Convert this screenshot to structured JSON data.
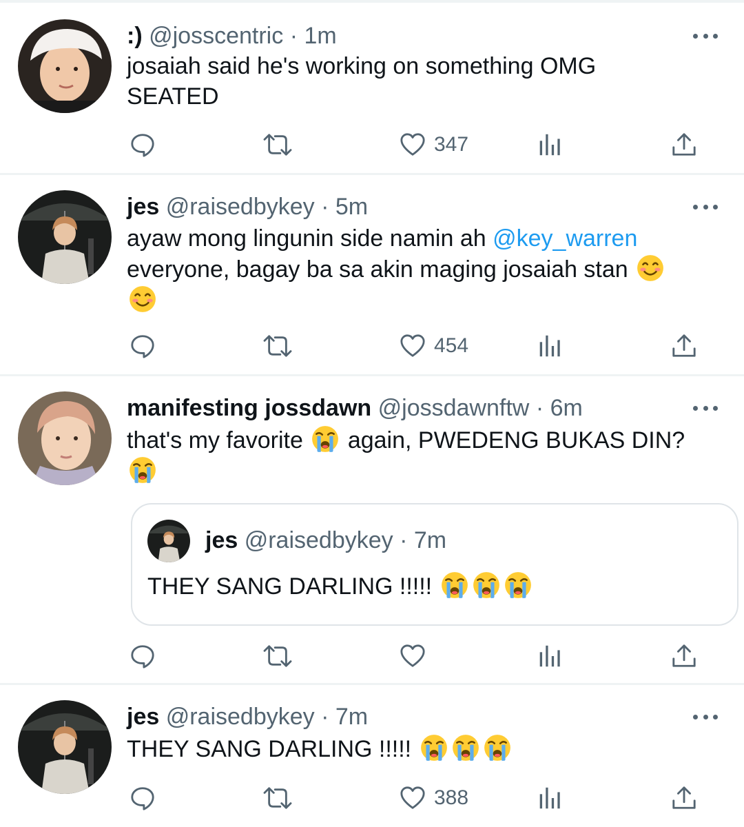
{
  "tweets": [
    {
      "name": ":)",
      "handle": "@josscentric",
      "separator": "·",
      "time": "1m",
      "text_line1": "josaiah said he's working on something OMG",
      "text_line2": "SEATED",
      "likes": "347",
      "avatar_icon": "avatar-photo"
    },
    {
      "name": "jes",
      "handle": "@raisedbykey",
      "separator": "·",
      "time": "5m",
      "text_part1": "ayaw mong lingunin side namin ah",
      "mention": "@key_warren",
      "text_line2": "everyone, bagay ba sa akin maging josaiah stan",
      "emoji": "smiling-face-emoji",
      "likes": "454",
      "avatar_icon": "avatar-photo"
    },
    {
      "name": "manifesting jossdawn",
      "handle": "@jossdawnftw",
      "separator": "·",
      "time": "6m",
      "text_part1": "that's my favorite",
      "text_part2": "again, PWEDENG BUKAS DIN?",
      "emoji": "loudly-crying-face-emoji",
      "likes": "",
      "avatar_icon": "avatar-photo",
      "quote": {
        "name": "jes",
        "handle": "@raisedbykey",
        "separator": "·",
        "time": "7m",
        "text": "THEY SANG DARLING !!!!!"
      }
    },
    {
      "name": "jes",
      "handle": "@raisedbykey",
      "separator": "·",
      "time": "7m",
      "text": "THEY SANG DARLING !!!!!",
      "likes": "388",
      "avatar_icon": "avatar-photo"
    }
  ],
  "colors": {
    "text": "#0f1419",
    "muted": "#536471",
    "link": "#1d9bf0",
    "divider": "#eff3f4"
  },
  "icons": [
    "reply-icon",
    "retweet-icon",
    "heart-icon",
    "analytics-icon",
    "share-icon",
    "more-icon"
  ]
}
